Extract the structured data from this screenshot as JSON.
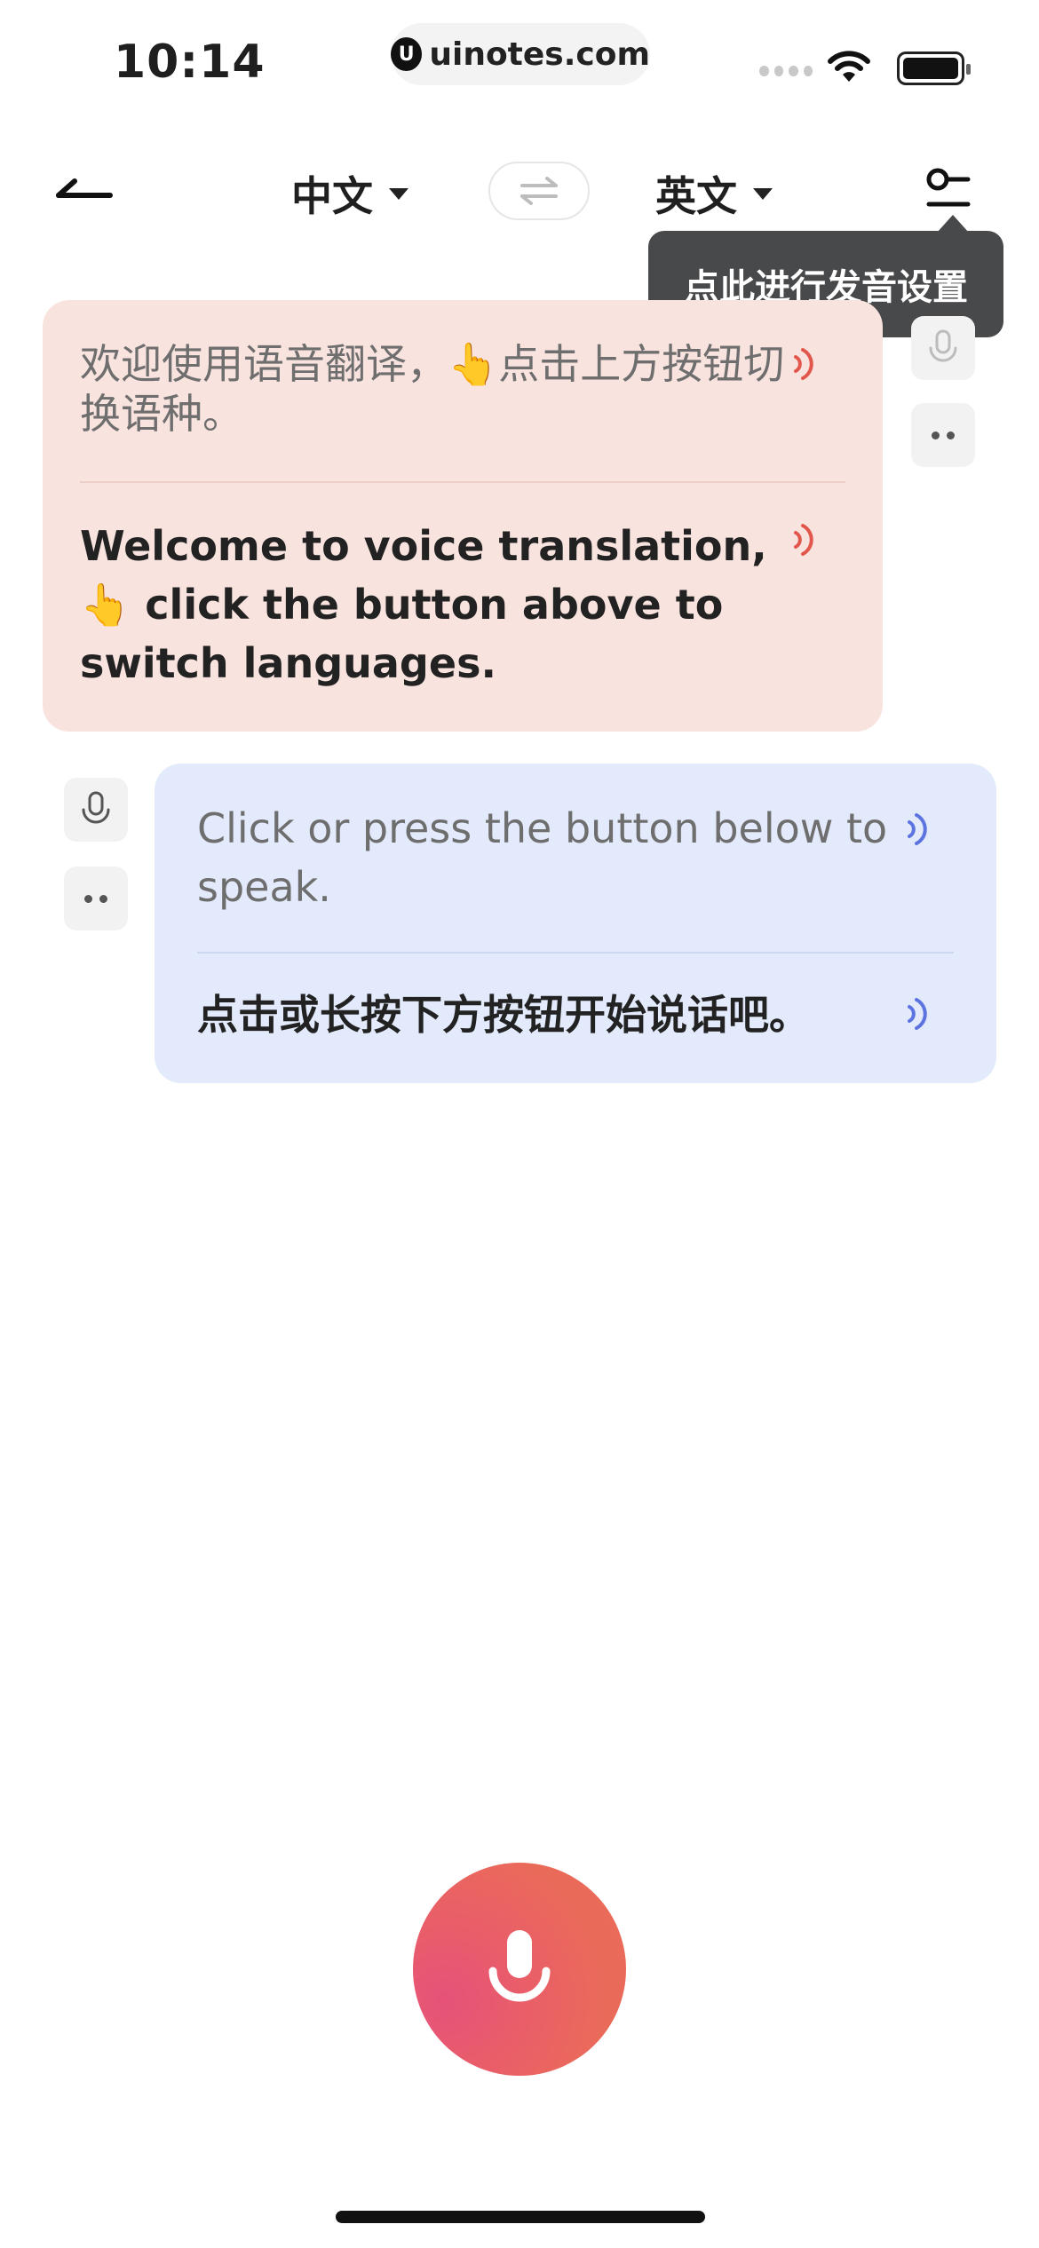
{
  "status_bar": {
    "time": "10:14",
    "url": "uinotes.com"
  },
  "nav": {
    "source_lang": "中文",
    "target_lang": "英文"
  },
  "tooltip": {
    "text": "点此进行发音设置"
  },
  "messages": [
    {
      "side": "left",
      "source_text": "欢迎使用语音翻译，👆点击上方按钮切换语种。",
      "translated_text": "Welcome to  voice translation, 👆 click the button above to switch languages.",
      "accent_color": "#e2574c"
    },
    {
      "side": "right",
      "source_text": "Click or press the button below to speak.",
      "translated_text": "点击或长按下方按钮开始说话吧。",
      "accent_color": "#5b74e0"
    }
  ],
  "icons": {
    "back": "back-arrow-icon",
    "swap": "swap-languages-icon",
    "settings": "pronunciation-settings-icon",
    "mic": "microphone-icon",
    "more": "more-dots-icon",
    "speaker": "speaker-wave-icon"
  },
  "colors": {
    "left_bubble": "#f8e3df",
    "right_bubble": "#e2eafb",
    "mic_button": "#e96c58"
  }
}
